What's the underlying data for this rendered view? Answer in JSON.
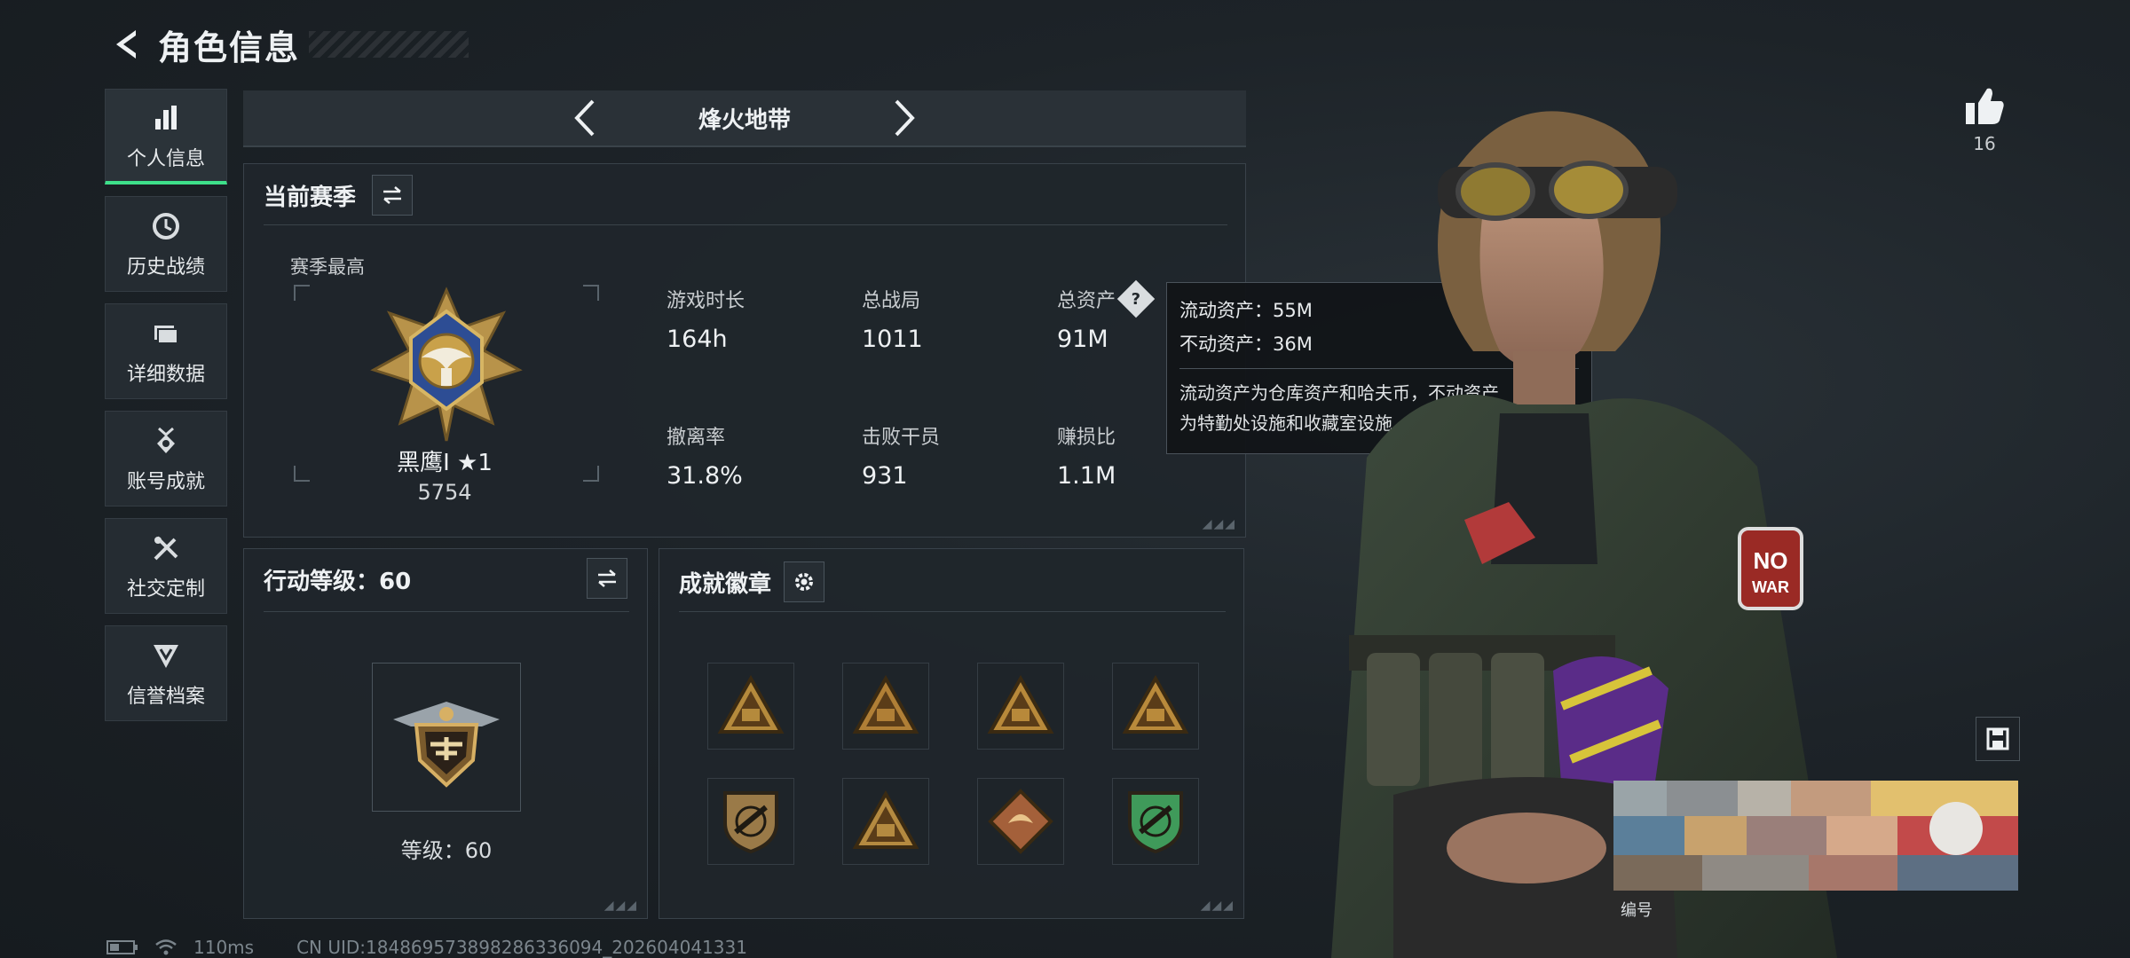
{
  "header": {
    "title": "角色信息"
  },
  "sidebar": {
    "items": [
      {
        "label": "个人信息",
        "icon": "bar-chart-icon",
        "active": true
      },
      {
        "label": "历史战绩",
        "icon": "clock-icon",
        "active": false
      },
      {
        "label": "详细数据",
        "icon": "folder-icon",
        "active": false
      },
      {
        "label": "账号成就",
        "icon": "medal-icon",
        "active": false
      },
      {
        "label": "社交定制",
        "icon": "tools-icon",
        "active": false
      },
      {
        "label": "信誉档案",
        "icon": "shield-icon",
        "active": false
      }
    ]
  },
  "map_selector": {
    "name": "烽火地带"
  },
  "season": {
    "title": "当前赛季",
    "season_high_label": "赛季最高",
    "rank_name": "黑鹰I ★1",
    "rank_score": "5754",
    "stats": [
      {
        "label": "游戏时长",
        "value": "164h"
      },
      {
        "label": "总战局",
        "value": "1011"
      },
      {
        "label": "总资产",
        "value": "91M"
      },
      {
        "label": "撤离率",
        "value": "31.8%"
      },
      {
        "label": "击败干员",
        "value": "931"
      },
      {
        "label": "赚损比",
        "value": "1.1M"
      }
    ]
  },
  "tooltip": {
    "liquid": "流动资产：55M",
    "fixed": "不动资产：36M",
    "desc_line1": "流动资产为仓库资产和哈夫币，不动资产",
    "desc_line2": "为特勤处设施和收藏室设施"
  },
  "level": {
    "title": "行动等级：60",
    "label": "等级：60",
    "value": 60
  },
  "achievements": {
    "title": "成就徽章",
    "badges": [
      {
        "icon": "badge-triangle-58-icon",
        "color": "#b58a3c"
      },
      {
        "icon": "badge-triangle-figure-icon",
        "color": "#b07f36"
      },
      {
        "icon": "badge-triangle-crouch-icon",
        "color": "#b8893a"
      },
      {
        "icon": "badge-triangle-team-icon",
        "color": "#b98a3b"
      },
      {
        "icon": "badge-shield-rifle-icon",
        "color": "#9a7a48"
      },
      {
        "icon": "badge-triangle-rocket-icon",
        "color": "#b48a40"
      },
      {
        "icon": "badge-diamond-dragon-icon",
        "color": "#a4603a"
      },
      {
        "icon": "badge-shield-green-icon",
        "color": "#3f9a5a"
      }
    ]
  },
  "right": {
    "like_count": "16",
    "card_label": "编号"
  },
  "status_bar": {
    "ping": "110ms",
    "uid": "CN UID:184869573898286336094_202604041331"
  },
  "colors": {
    "accent": "#3ee08a",
    "panel": "#20262b",
    "gold": "#c9a14a"
  }
}
